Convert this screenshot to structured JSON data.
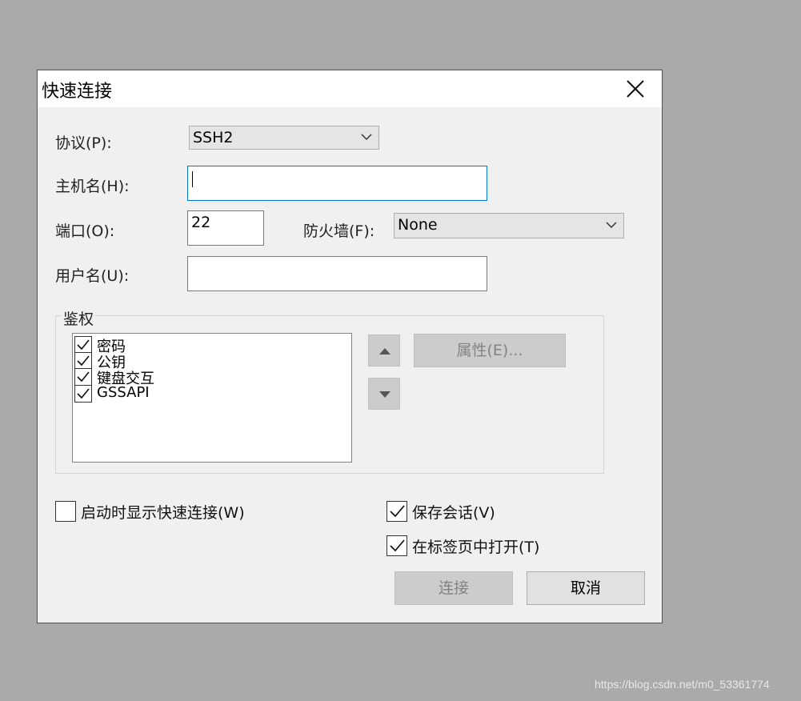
{
  "dialog": {
    "title": "快速连接",
    "close_icon": "close-icon"
  },
  "form": {
    "protocol_label": "协议(P):",
    "protocol_value": "SSH2",
    "hostname_label": "主机名(H):",
    "hostname_value": "",
    "port_label": "端口(O):",
    "port_value": "22",
    "firewall_label": "防火墙(F):",
    "firewall_value": "None",
    "username_label": "用户名(U):",
    "username_value": ""
  },
  "auth": {
    "group_label": "鉴权",
    "methods": [
      {
        "label": "密码",
        "checked": true
      },
      {
        "label": "公钥",
        "checked": true
      },
      {
        "label": "键盘交互",
        "checked": true
      },
      {
        "label": "GSSAPI",
        "checked": true
      }
    ],
    "properties_button": "属性(E)..."
  },
  "options": {
    "show_on_startup_label": "启动时显示快速连接(W)",
    "show_on_startup_checked": false,
    "save_session_label": "保存会话(V)",
    "save_session_checked": true,
    "open_in_tab_label": "在标签页中打开(T)",
    "open_in_tab_checked": true
  },
  "buttons": {
    "connect": "连接",
    "cancel": "取消"
  },
  "watermark": "https://blog.csdn.net/m0_53361774"
}
